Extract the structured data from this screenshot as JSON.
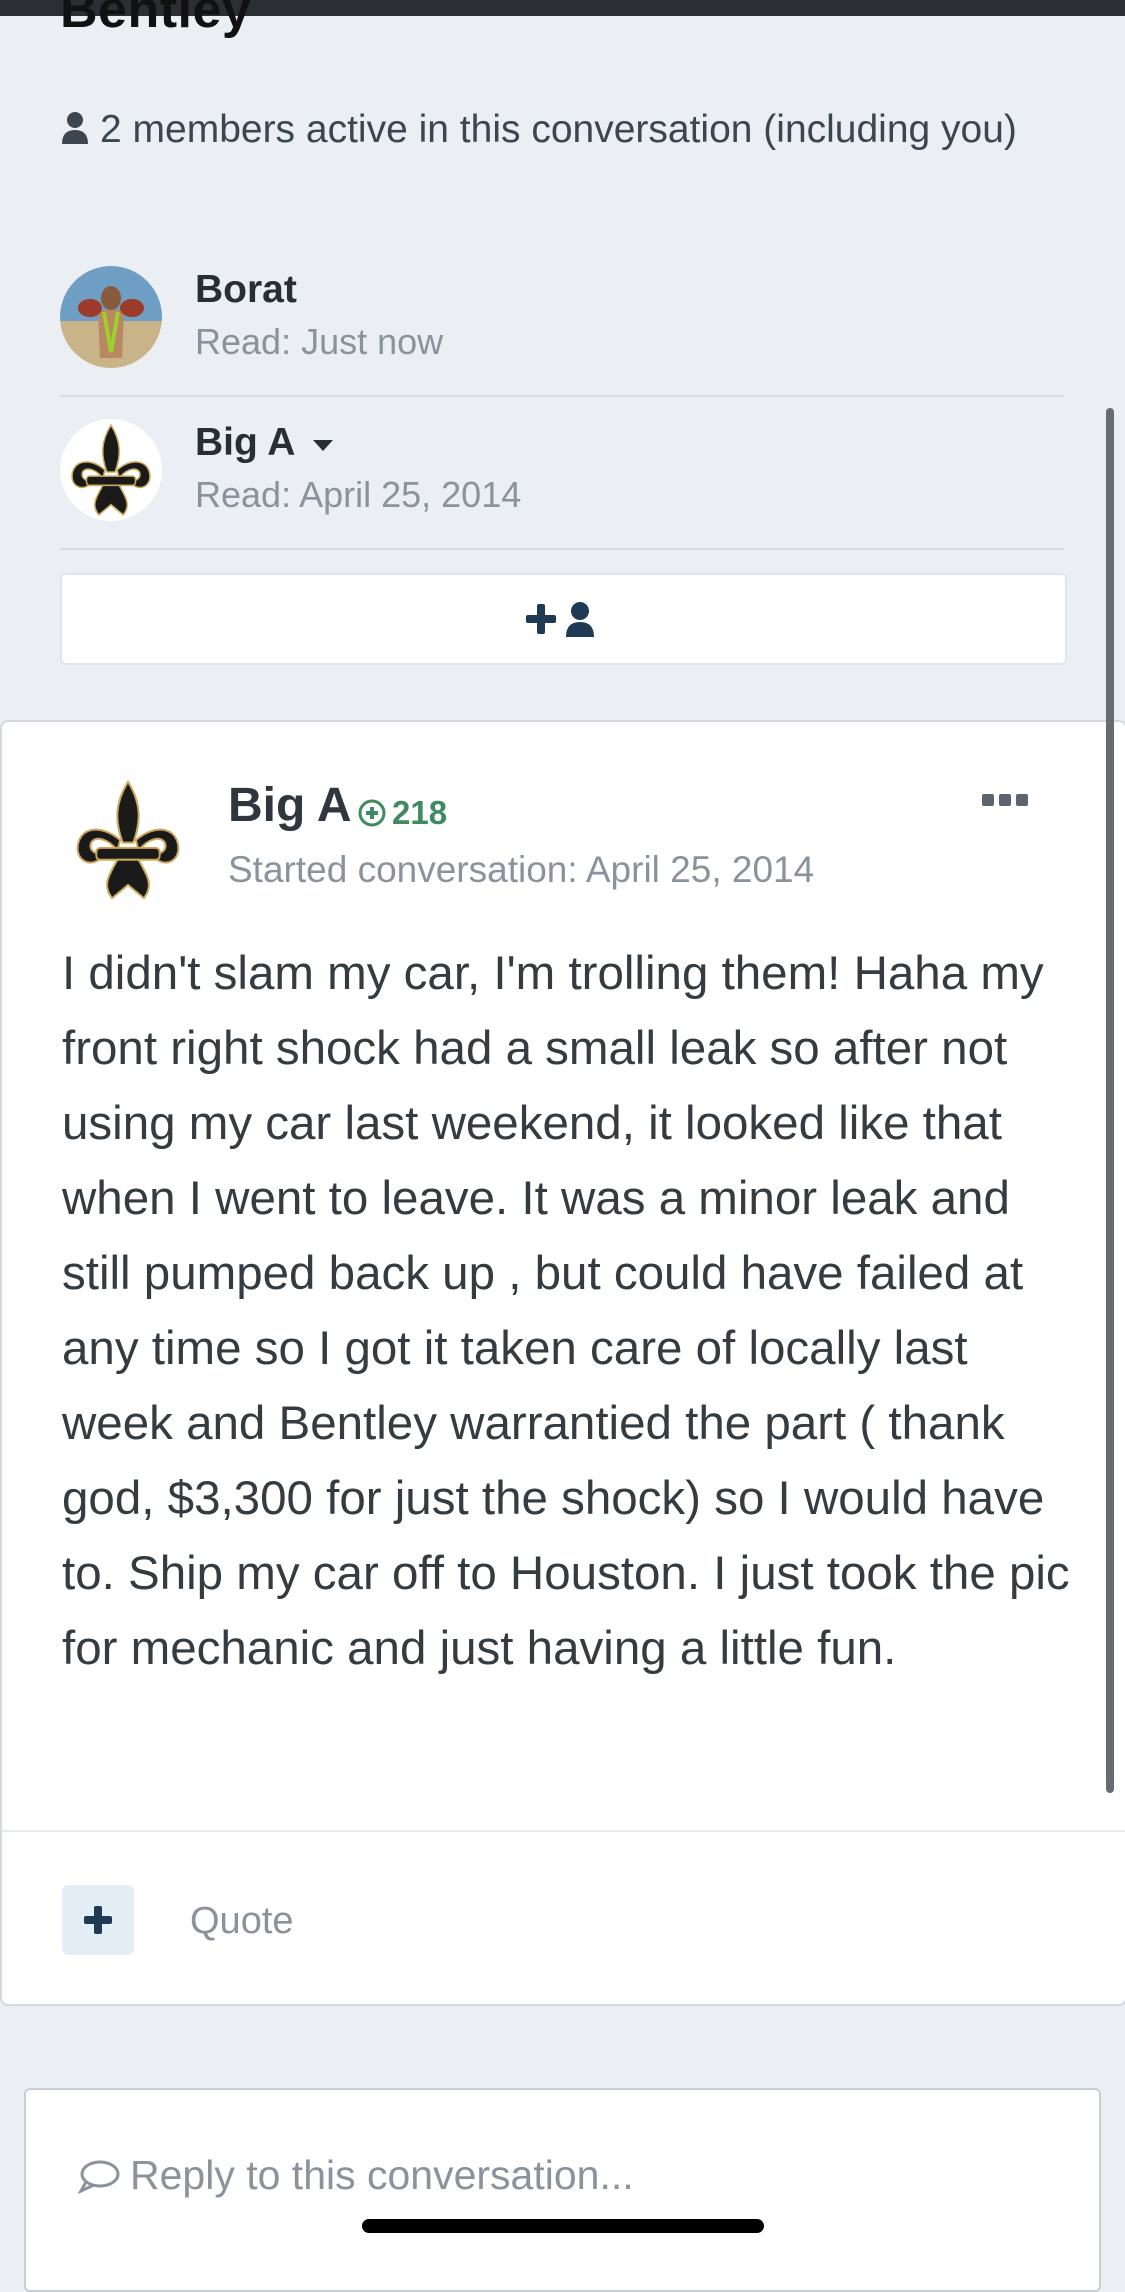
{
  "page": {
    "title_fragment": "Bentley"
  },
  "conversation": {
    "active_text": "2 members active in this conversation (including you)",
    "members": [
      {
        "name": "Borat",
        "read": "Read: Just now"
      },
      {
        "name": "Big A",
        "read": "Read: April 25, 2014"
      }
    ]
  },
  "post": {
    "author": "Big A",
    "reputation": "218",
    "started": "Started conversation: April 25, 2014",
    "body": "I didn't slam my car, I'm trolling them! Haha my front right shock had a small leak so after not using my car last weekend, it looked like that when I went to leave. It was a minor leak and still pumped back up , but could have failed at any time so I got it taken care of locally last week and Bentley warrantied the part ( thank god, $3,300 for just the shock) so I would have to. Ship my car off to Houston. I just took the pic for mechanic and just having a little fun.",
    "quote_label": "Quote"
  },
  "reply": {
    "placeholder": "Reply to this conversation..."
  },
  "icons": {
    "person": "person-icon",
    "caret": "caret-down-icon",
    "add_user": "add-user-icon",
    "rep_plus": "plus-circle-icon",
    "more": "more-dots-icon",
    "plus": "plus-icon",
    "comment": "comment-icon"
  },
  "colors": {
    "accent_dark": "#1e3a54",
    "reputation_green": "#3f8a5e",
    "muted_text": "#8a929c"
  }
}
